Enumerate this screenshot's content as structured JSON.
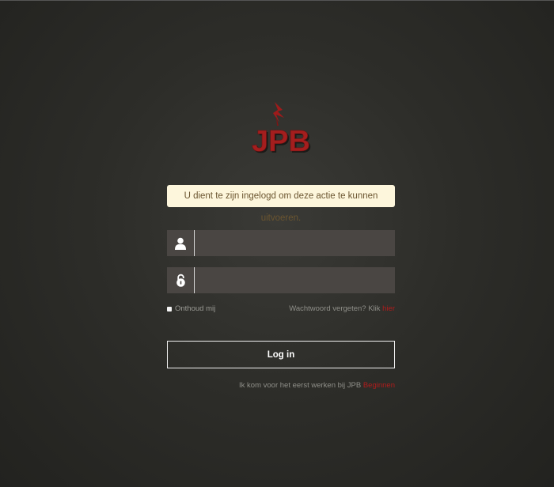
{
  "logo": {
    "text": "JPB"
  },
  "alert": {
    "message": "U dient te zijn ingelogd om deze actie te kunnen uitvoeren."
  },
  "username": {
    "value": "",
    "placeholder": "",
    "icon": "user-icon"
  },
  "password": {
    "value": "",
    "placeholder": "",
    "icon": "lock-icon"
  },
  "remember": {
    "label": "Onthoud mij"
  },
  "forgot": {
    "text": "Wachtwoord vergeten? Klik ",
    "link": "hier"
  },
  "login_button": {
    "label": "Log in"
  },
  "first_time": {
    "text": "Ik kom voor het eerst werken bij JPB ",
    "link": "Beginnen"
  },
  "colors": {
    "accent": "#b01c1c",
    "alert_bg": "#fdf6dc",
    "input_bg": "#4a4643",
    "background": "#2d2d29"
  }
}
